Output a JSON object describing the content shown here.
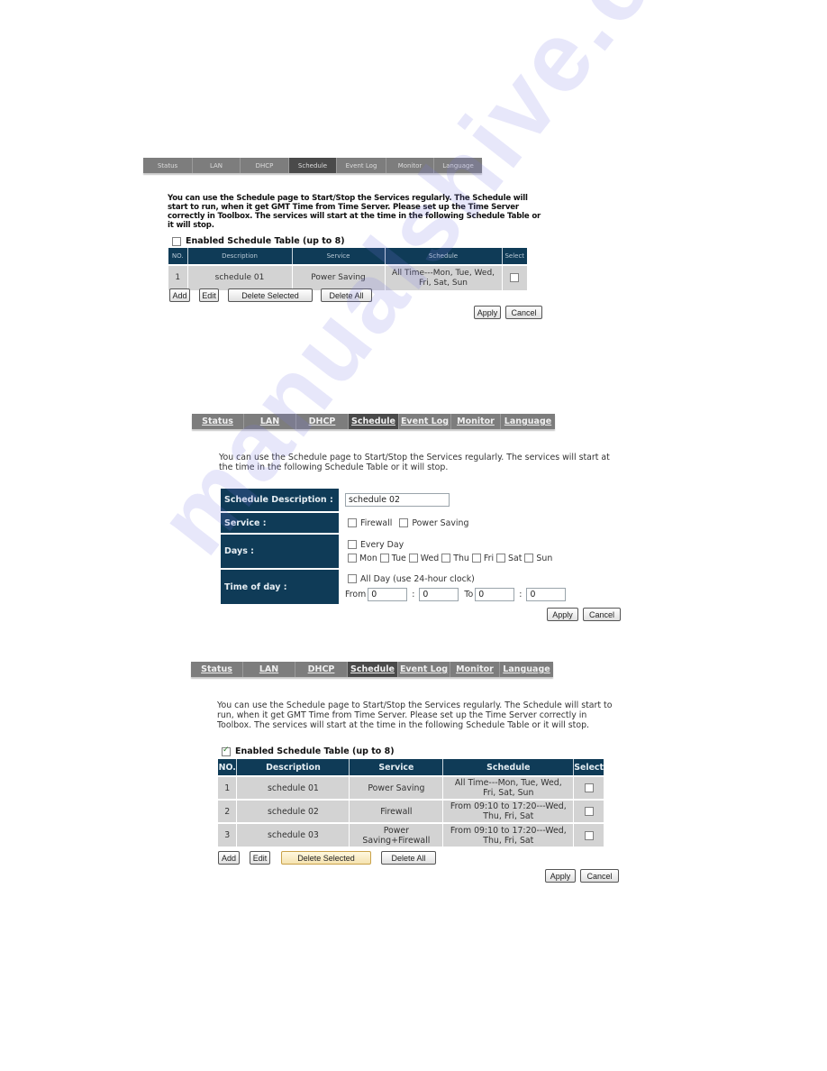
{
  "tabs": [
    "Status",
    "LAN",
    "DHCP",
    "Schedule",
    "Event Log",
    "Monitor",
    "Language"
  ],
  "active_tab": "Schedule",
  "section1": {
    "intro": "You can use the Schedule page to Start/Stop the Services regularly. The Schedule will start to run, when it get GMT Time from Time Server. Please set up the Time Server correctly in Toolbox. The services will start at the time in the following Schedule Table or it will stop.",
    "enabled_label": "Enabled Schedule Table (up to 8)",
    "enabled_checked": false,
    "headers": [
      "NO.",
      "Description",
      "Service",
      "Schedule",
      "Select"
    ],
    "rows": [
      {
        "no": "1",
        "description": "schedule 01",
        "service": "Power Saving",
        "schedule": "All Time---Mon, Tue, Wed, Fri, Sat, Sun"
      }
    ],
    "buttons": {
      "add": "Add",
      "edit": "Edit",
      "delete_selected": "Delete Selected",
      "delete_all": "Delete All",
      "apply": "Apply",
      "cancel": "Cancel"
    }
  },
  "section2": {
    "intro": "You can use the Schedule page to Start/Stop the Services regularly. The services will start at the time in the following Schedule Table or it will stop.",
    "labels": {
      "description": "Schedule Description :",
      "service": "Service :",
      "days": "Days :",
      "time": "Time of day :"
    },
    "description_value": "schedule 02",
    "services": [
      "Firewall",
      "Power Saving"
    ],
    "every_day": "Every Day",
    "days": [
      "Mon",
      "Tue",
      "Wed",
      "Thu",
      "Fri",
      "Sat",
      "Sun"
    ],
    "all_day": "All Day (use 24-hour clock)",
    "from_label": "From",
    "to_label": "To",
    "colon": ":",
    "from_hour": "0",
    "from_min": "0",
    "to_hour": "0",
    "to_min": "0",
    "buttons": {
      "apply": "Apply",
      "cancel": "Cancel"
    }
  },
  "section3": {
    "intro": "You can use the Schedule page to Start/Stop the Services regularly. The Schedule will start to run, when it get GMT Time from Time Server. Please set up the Time Server correctly in Toolbox. The services will start at the time in the following Schedule Table or it will stop.",
    "enabled_label": "Enabled Schedule Table (up to 8)",
    "enabled_checked": true,
    "headers": [
      "NO.",
      "Description",
      "Service",
      "Schedule",
      "Select"
    ],
    "rows": [
      {
        "no": "1",
        "description": "schedule 01",
        "service": "Power Saving",
        "schedule": "All Time---Mon, Tue, Wed, Fri, Sat, Sun"
      },
      {
        "no": "2",
        "description": "schedule 02",
        "service": "Firewall",
        "schedule": "From 09:10 to 17:20---Wed, Thu, Fri, Sat"
      },
      {
        "no": "3",
        "description": "schedule 03",
        "service": "Power Saving+Firewall",
        "schedule": "From 09:10 to 17:20---Wed, Thu, Fri, Sat"
      }
    ],
    "buttons": {
      "add": "Add",
      "edit": "Edit",
      "delete_selected": "Delete Selected",
      "delete_all": "Delete All",
      "apply": "Apply",
      "cancel": "Cancel"
    }
  },
  "watermark": "manualshive.com"
}
